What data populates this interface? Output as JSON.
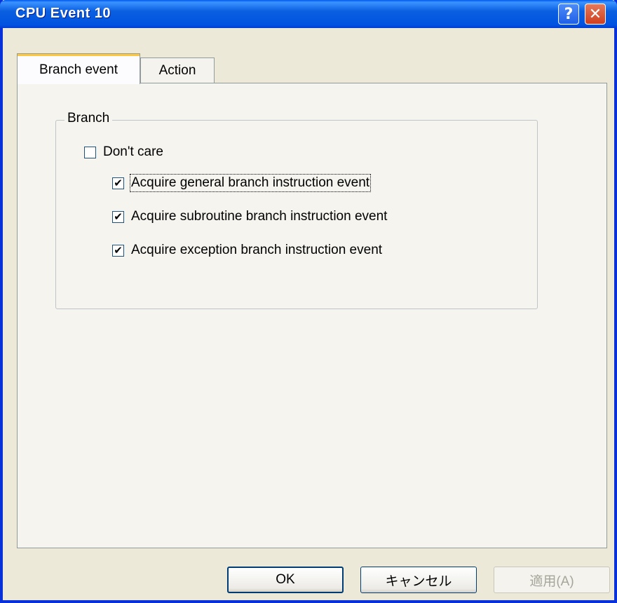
{
  "window": {
    "title": "CPU Event 10",
    "help_glyph": "?",
    "close_glyph": "✕"
  },
  "tabs": [
    {
      "label": "Branch event",
      "active": true
    },
    {
      "label": "Action",
      "active": false
    }
  ],
  "branch_group": {
    "label": "Branch",
    "options": [
      {
        "label": "Don't care",
        "checked": false
      },
      {
        "label": "Acquire general branch instruction event",
        "checked": true
      },
      {
        "label": "Acquire subroutine branch instruction event",
        "checked": true
      },
      {
        "label": "Acquire exception branch instruction event",
        "checked": true
      }
    ]
  },
  "buttons": {
    "ok": "OK",
    "cancel": "キャンセル",
    "apply": "適用(A)"
  },
  "check_glyph": "✔"
}
